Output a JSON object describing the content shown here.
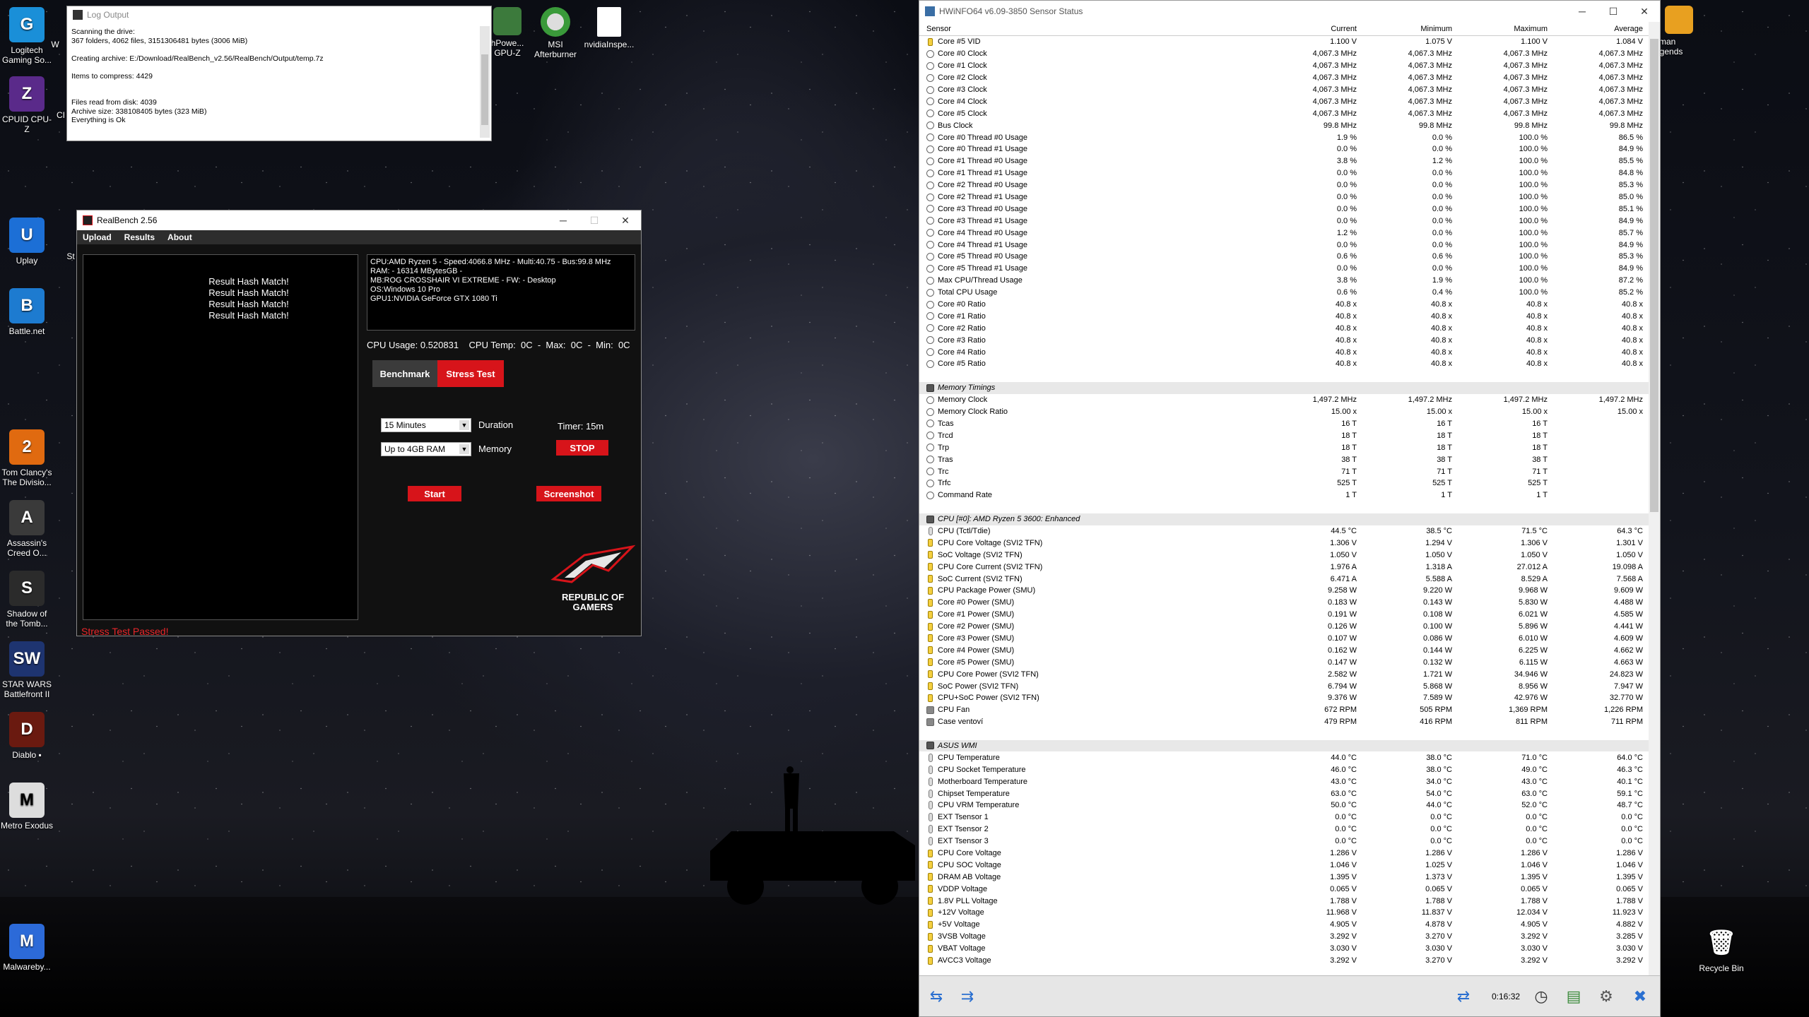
{
  "desktop": {
    "icons_left": [
      {
        "label": "Logitech Gaming So...",
        "glyph": "G",
        "color": "#1a8fd8"
      },
      {
        "label": "CPUID CPU-Z",
        "glyph": "Z",
        "color": "#5a2a8a"
      },
      {
        "label": "Uplay",
        "glyph": "U",
        "color": "#1c6fd6"
      },
      {
        "label": "Battle.net",
        "glyph": "B",
        "color": "#1d7bd0"
      },
      {
        "label": "Tom Clancy's The Divisio...",
        "glyph": "2",
        "color": "#e06a10"
      },
      {
        "label": "Assassin's Creed O...",
        "glyph": "A",
        "color": "#3a3a3a"
      },
      {
        "label": "Shadow of the Tomb...",
        "glyph": "S",
        "color": "#2b2b2b"
      },
      {
        "label": "STAR WARS Battlefront II",
        "glyph": "SW",
        "color": "#1e3470"
      },
      {
        "label": "Diablo ▪",
        "glyph": "D",
        "color": "#6a1a10"
      },
      {
        "label": "Metro Exodus",
        "glyph": "M",
        "color": "#ddd"
      },
      {
        "label": "Malwareby...",
        "glyph": "M",
        "color": "#2c6ad8"
      }
    ],
    "icons_partial": [
      {
        "label": "W",
        "glyph": ""
      },
      {
        "label": "CI",
        "glyph": ""
      },
      {
        "label": "St",
        "glyph": ""
      }
    ],
    "icons_top": [
      {
        "label": "hPowe... GPU-Z",
        "glyph": "",
        "color": "#3c7a3c"
      },
      {
        "label": "MSI Afterburner",
        "glyph": "MSI",
        "color": "#3a9a3a"
      },
      {
        "label": "nvidiaInspe...",
        "glyph": "",
        "color": "#ffffff"
      }
    ],
    "icon_right_top": {
      "label": "yman egends",
      "glyph": "R",
      "color": "#e8a020"
    },
    "recycle_bin": {
      "label": "Recycle Bin",
      "glyph": "🗑"
    }
  },
  "log_window": {
    "title": "Log Output",
    "lines": [
      "Scanning the drive:",
      "367 folders, 4062 files, 3151306481 bytes (3006 MiB)",
      "",
      "Creating archive: E:/Download/RealBench_v2.56/RealBench/Output/temp.7z",
      "",
      "Items to compress: 4429",
      "",
      "",
      "Files read from disk: 4039",
      "Archive size: 338108405 bytes (323 MiB)",
      "Everything is Ok"
    ]
  },
  "realbench": {
    "title": "RealBench 2.56",
    "menu": [
      "Upload",
      "Results",
      "About"
    ],
    "hash_results": [
      "Result Hash Match!",
      "Result Hash Match!",
      "Result Hash Match!",
      "Result Hash Match!"
    ],
    "sysinfo": [
      "CPU:AMD Ryzen 5 - Speed:4066.8 MHz - Multi:40.75 - Bus:99.8 MHz",
      "RAM: - 16314 MBytesGB -",
      "MB:ROG CROSSHAIR VI EXTREME - FW: - Desktop",
      "OS:Windows 10 Pro",
      "GPU1:NVIDIA GeForce GTX 1080 Ti"
    ],
    "cpu_line": "CPU Usage: 0.520831    CPU Temp:  0C  -  Max:  0C  -  Min:  0C",
    "tab_benchmark": "Benchmark",
    "tab_stress": "Stress Test",
    "duration_value": "15 Minutes",
    "duration_label": "Duration",
    "memory_value": "Up to 4GB RAM",
    "memory_label": "Memory",
    "timer": "Timer: 15m",
    "stop": "STOP",
    "start": "Start",
    "screenshot": "Screenshot",
    "status": "Stress Test Passed!",
    "logo_text": "REPUBLIC OF GAMERS"
  },
  "hwinfo": {
    "title": "HWiNFO64 v6.09-3850 Sensor Status",
    "columns": [
      "Sensor",
      "Current",
      "Minimum",
      "Maximum",
      "Average"
    ],
    "elapsed": "0:16:32",
    "rows": [
      {
        "t": "volt",
        "n": "Core #5 VID",
        "c": "1.100 V",
        "mi": "1.075 V",
        "ma": "1.100 V",
        "av": "1.084 V"
      },
      {
        "t": "clk",
        "n": "Core #0 Clock",
        "c": "4,067.3 MHz",
        "mi": "4,067.3 MHz",
        "ma": "4,067.3 MHz",
        "av": "4,067.3 MHz"
      },
      {
        "t": "clk",
        "n": "Core #1 Clock",
        "c": "4,067.3 MHz",
        "mi": "4,067.3 MHz",
        "ma": "4,067.3 MHz",
        "av": "4,067.3 MHz"
      },
      {
        "t": "clk",
        "n": "Core #2 Clock",
        "c": "4,067.3 MHz",
        "mi": "4,067.3 MHz",
        "ma": "4,067.3 MHz",
        "av": "4,067.3 MHz"
      },
      {
        "t": "clk",
        "n": "Core #3 Clock",
        "c": "4,067.3 MHz",
        "mi": "4,067.3 MHz",
        "ma": "4,067.3 MHz",
        "av": "4,067.3 MHz"
      },
      {
        "t": "clk",
        "n": "Core #4 Clock",
        "c": "4,067.3 MHz",
        "mi": "4,067.3 MHz",
        "ma": "4,067.3 MHz",
        "av": "4,067.3 MHz"
      },
      {
        "t": "clk",
        "n": "Core #5 Clock",
        "c": "4,067.3 MHz",
        "mi": "4,067.3 MHz",
        "ma": "4,067.3 MHz",
        "av": "4,067.3 MHz"
      },
      {
        "t": "clk",
        "n": "Bus Clock",
        "c": "99.8 MHz",
        "mi": "99.8 MHz",
        "ma": "99.8 MHz",
        "av": "99.8 MHz"
      },
      {
        "t": "clk",
        "n": "Core #0 Thread #0 Usage",
        "c": "1.9 %",
        "mi": "0.0 %",
        "ma": "100.0 %",
        "av": "86.5 %"
      },
      {
        "t": "clk",
        "n": "Core #0 Thread #1 Usage",
        "c": "0.0 %",
        "mi": "0.0 %",
        "ma": "100.0 %",
        "av": "84.9 %"
      },
      {
        "t": "clk",
        "n": "Core #1 Thread #0 Usage",
        "c": "3.8 %",
        "mi": "1.2 %",
        "ma": "100.0 %",
        "av": "85.5 %"
      },
      {
        "t": "clk",
        "n": "Core #1 Thread #1 Usage",
        "c": "0.0 %",
        "mi": "0.0 %",
        "ma": "100.0 %",
        "av": "84.8 %"
      },
      {
        "t": "clk",
        "n": "Core #2 Thread #0 Usage",
        "c": "0.0 %",
        "mi": "0.0 %",
        "ma": "100.0 %",
        "av": "85.3 %"
      },
      {
        "t": "clk",
        "n": "Core #2 Thread #1 Usage",
        "c": "0.0 %",
        "mi": "0.0 %",
        "ma": "100.0 %",
        "av": "85.0 %"
      },
      {
        "t": "clk",
        "n": "Core #3 Thread #0 Usage",
        "c": "0.0 %",
        "mi": "0.0 %",
        "ma": "100.0 %",
        "av": "85.1 %"
      },
      {
        "t": "clk",
        "n": "Core #3 Thread #1 Usage",
        "c": "0.0 %",
        "mi": "0.0 %",
        "ma": "100.0 %",
        "av": "84.9 %"
      },
      {
        "t": "clk",
        "n": "Core #4 Thread #0 Usage",
        "c": "1.2 %",
        "mi": "0.0 %",
        "ma": "100.0 %",
        "av": "85.7 %"
      },
      {
        "t": "clk",
        "n": "Core #4 Thread #1 Usage",
        "c": "0.0 %",
        "mi": "0.0 %",
        "ma": "100.0 %",
        "av": "84.9 %"
      },
      {
        "t": "clk",
        "n": "Core #5 Thread #0 Usage",
        "c": "0.6 %",
        "mi": "0.6 %",
        "ma": "100.0 %",
        "av": "85.3 %"
      },
      {
        "t": "clk",
        "n": "Core #5 Thread #1 Usage",
        "c": "0.0 %",
        "mi": "0.0 %",
        "ma": "100.0 %",
        "av": "84.9 %"
      },
      {
        "t": "clk",
        "n": "Max CPU/Thread Usage",
        "c": "3.8 %",
        "mi": "1.9 %",
        "ma": "100.0 %",
        "av": "87.2 %"
      },
      {
        "t": "clk",
        "n": "Total CPU Usage",
        "c": "0.6 %",
        "mi": "0.4 %",
        "ma": "100.0 %",
        "av": "85.2 %"
      },
      {
        "t": "clk",
        "n": "Core #0 Ratio",
        "c": "40.8 x",
        "mi": "40.8 x",
        "ma": "40.8 x",
        "av": "40.8 x"
      },
      {
        "t": "clk",
        "n": "Core #1 Ratio",
        "c": "40.8 x",
        "mi": "40.8 x",
        "ma": "40.8 x",
        "av": "40.8 x"
      },
      {
        "t": "clk",
        "n": "Core #2 Ratio",
        "c": "40.8 x",
        "mi": "40.8 x",
        "ma": "40.8 x",
        "av": "40.8 x"
      },
      {
        "t": "clk",
        "n": "Core #3 Ratio",
        "c": "40.8 x",
        "mi": "40.8 x",
        "ma": "40.8 x",
        "av": "40.8 x"
      },
      {
        "t": "clk",
        "n": "Core #4 Ratio",
        "c": "40.8 x",
        "mi": "40.8 x",
        "ma": "40.8 x",
        "av": "40.8 x"
      },
      {
        "t": "clk",
        "n": "Core #5 Ratio",
        "c": "40.8 x",
        "mi": "40.8 x",
        "ma": "40.8 x",
        "av": "40.8 x"
      },
      {
        "t": "gap"
      },
      {
        "t": "sec",
        "n": "Memory Timings"
      },
      {
        "t": "clk",
        "n": "Memory Clock",
        "c": "1,497.2 MHz",
        "mi": "1,497.2 MHz",
        "ma": "1,497.2 MHz",
        "av": "1,497.2 MHz"
      },
      {
        "t": "clk",
        "n": "Memory Clock Ratio",
        "c": "15.00 x",
        "mi": "15.00 x",
        "ma": "15.00 x",
        "av": "15.00 x"
      },
      {
        "t": "clk",
        "n": "Tcas",
        "c": "16 T",
        "mi": "16 T",
        "ma": "16 T",
        "av": ""
      },
      {
        "t": "clk",
        "n": "Trcd",
        "c": "18 T",
        "mi": "18 T",
        "ma": "18 T",
        "av": ""
      },
      {
        "t": "clk",
        "n": "Trp",
        "c": "18 T",
        "mi": "18 T",
        "ma": "18 T",
        "av": ""
      },
      {
        "t": "clk",
        "n": "Tras",
        "c": "38 T",
        "mi": "38 T",
        "ma": "38 T",
        "av": ""
      },
      {
        "t": "clk",
        "n": "Trc",
        "c": "71 T",
        "mi": "71 T",
        "ma": "71 T",
        "av": ""
      },
      {
        "t": "clk",
        "n": "Trfc",
        "c": "525 T",
        "mi": "525 T",
        "ma": "525 T",
        "av": ""
      },
      {
        "t": "clk",
        "n": "Command Rate",
        "c": "1 T",
        "mi": "1 T",
        "ma": "1 T",
        "av": ""
      },
      {
        "t": "gap"
      },
      {
        "t": "sec",
        "n": "CPU [#0]: AMD Ryzen 5 3600: Enhanced"
      },
      {
        "t": "temp",
        "n": "CPU (Tctl/Tdie)",
        "c": "44.5 °C",
        "mi": "38.5 °C",
        "ma": "71.5 °C",
        "av": "64.3 °C"
      },
      {
        "t": "volt",
        "n": "CPU Core Voltage (SVI2 TFN)",
        "c": "1.306 V",
        "mi": "1.294 V",
        "ma": "1.306 V",
        "av": "1.301 V"
      },
      {
        "t": "volt",
        "n": "SoC Voltage (SVI2 TFN)",
        "c": "1.050 V",
        "mi": "1.050 V",
        "ma": "1.050 V",
        "av": "1.050 V"
      },
      {
        "t": "volt",
        "n": "CPU Core Current (SVI2 TFN)",
        "c": "1.976 A",
        "mi": "1.318 A",
        "ma": "27.012 A",
        "av": "19.098 A"
      },
      {
        "t": "volt",
        "n": "SoC Current (SVI2 TFN)",
        "c": "6.471 A",
        "mi": "5.588 A",
        "ma": "8.529 A",
        "av": "7.568 A"
      },
      {
        "t": "volt",
        "n": "CPU Package Power (SMU)",
        "c": "9.258 W",
        "mi": "9.220 W",
        "ma": "9.968 W",
        "av": "9.609 W"
      },
      {
        "t": "volt",
        "n": "Core #0 Power (SMU)",
        "c": "0.183 W",
        "mi": "0.143 W",
        "ma": "5.830 W",
        "av": "4.488 W"
      },
      {
        "t": "volt",
        "n": "Core #1 Power (SMU)",
        "c": "0.191 W",
        "mi": "0.108 W",
        "ma": "6.021 W",
        "av": "4.585 W"
      },
      {
        "t": "volt",
        "n": "Core #2 Power (SMU)",
        "c": "0.126 W",
        "mi": "0.100 W",
        "ma": "5.896 W",
        "av": "4.441 W"
      },
      {
        "t": "volt",
        "n": "Core #3 Power (SMU)",
        "c": "0.107 W",
        "mi": "0.086 W",
        "ma": "6.010 W",
        "av": "4.609 W"
      },
      {
        "t": "volt",
        "n": "Core #4 Power (SMU)",
        "c": "0.162 W",
        "mi": "0.144 W",
        "ma": "6.225 W",
        "av": "4.662 W"
      },
      {
        "t": "volt",
        "n": "Core #5 Power (SMU)",
        "c": "0.147 W",
        "mi": "0.132 W",
        "ma": "6.115 W",
        "av": "4.663 W"
      },
      {
        "t": "volt",
        "n": "CPU Core Power (SVI2 TFN)",
        "c": "2.582 W",
        "mi": "1.721 W",
        "ma": "34.946 W",
        "av": "24.823 W"
      },
      {
        "t": "volt",
        "n": "SoC Power (SVI2 TFN)",
        "c": "6.794 W",
        "mi": "5.868 W",
        "ma": "8.956 W",
        "av": "7.947 W"
      },
      {
        "t": "volt",
        "n": "CPU+SoC Power (SVI2 TFN)",
        "c": "9.376 W",
        "mi": "7.589 W",
        "ma": "42.976 W",
        "av": "32.770 W"
      },
      {
        "t": "fan",
        "n": "CPU Fan",
        "c": "672 RPM",
        "mi": "505 RPM",
        "ma": "1,369 RPM",
        "av": "1,226 RPM"
      },
      {
        "t": "fan",
        "n": "Case ventoví",
        "c": "479 RPM",
        "mi": "416 RPM",
        "ma": "811 RPM",
        "av": "711 RPM"
      },
      {
        "t": "gap"
      },
      {
        "t": "sec",
        "n": "ASUS WMI"
      },
      {
        "t": "temp",
        "n": "CPU Temperature",
        "c": "44.0 °C",
        "mi": "38.0 °C",
        "ma": "71.0 °C",
        "av": "64.0 °C"
      },
      {
        "t": "temp",
        "n": "CPU Socket Temperature",
        "c": "46.0 °C",
        "mi": "38.0 °C",
        "ma": "49.0 °C",
        "av": "46.3 °C"
      },
      {
        "t": "temp",
        "n": "Motherboard Temperature",
        "c": "43.0 °C",
        "mi": "34.0 °C",
        "ma": "43.0 °C",
        "av": "40.1 °C"
      },
      {
        "t": "temp",
        "n": "Chipset Temperature",
        "c": "63.0 °C",
        "mi": "54.0 °C",
        "ma": "63.0 °C",
        "av": "59.1 °C"
      },
      {
        "t": "temp",
        "n": "CPU VRM Temperature",
        "c": "50.0 °C",
        "mi": "44.0 °C",
        "ma": "52.0 °C",
        "av": "48.7 °C"
      },
      {
        "t": "temp",
        "n": "EXT Tsensor 1",
        "c": "0.0 °C",
        "mi": "0.0 °C",
        "ma": "0.0 °C",
        "av": "0.0 °C"
      },
      {
        "t": "temp",
        "n": "EXT Tsensor 2",
        "c": "0.0 °C",
        "mi": "0.0 °C",
        "ma": "0.0 °C",
        "av": "0.0 °C"
      },
      {
        "t": "temp",
        "n": "EXT Tsensor 3",
        "c": "0.0 °C",
        "mi": "0.0 °C",
        "ma": "0.0 °C",
        "av": "0.0 °C"
      },
      {
        "t": "volt",
        "n": "CPU Core Voltage",
        "c": "1.286 V",
        "mi": "1.286 V",
        "ma": "1.286 V",
        "av": "1.286 V"
      },
      {
        "t": "volt",
        "n": "CPU SOC Voltage",
        "c": "1.046 V",
        "mi": "1.025 V",
        "ma": "1.046 V",
        "av": "1.046 V"
      },
      {
        "t": "volt",
        "n": "DRAM AB Voltage",
        "c": "1.395 V",
        "mi": "1.373 V",
        "ma": "1.395 V",
        "av": "1.395 V"
      },
      {
        "t": "volt",
        "n": "VDDP Voltage",
        "c": "0.065 V",
        "mi": "0.065 V",
        "ma": "0.065 V",
        "av": "0.065 V"
      },
      {
        "t": "volt",
        "n": "1.8V PLL Voltage",
        "c": "1.788 V",
        "mi": "1.788 V",
        "ma": "1.788 V",
        "av": "1.788 V"
      },
      {
        "t": "volt",
        "n": "+12V Voltage",
        "c": "11.968 V",
        "mi": "11.837 V",
        "ma": "12.034 V",
        "av": "11.923 V"
      },
      {
        "t": "volt",
        "n": "+5V Voltage",
        "c": "4.905 V",
        "mi": "4.878 V",
        "ma": "4.905 V",
        "av": "4.882 V"
      },
      {
        "t": "volt",
        "n": "3VSB Voltage",
        "c": "3.292 V",
        "mi": "3.270 V",
        "ma": "3.292 V",
        "av": "3.285 V"
      },
      {
        "t": "volt",
        "n": "VBAT Voltage",
        "c": "3.030 V",
        "mi": "3.030 V",
        "ma": "3.030 V",
        "av": "3.030 V"
      },
      {
        "t": "volt",
        "n": "AVCC3 Voltage",
        "c": "3.292 V",
        "mi": "3.270 V",
        "ma": "3.292 V",
        "av": "3.292 V"
      }
    ]
  }
}
